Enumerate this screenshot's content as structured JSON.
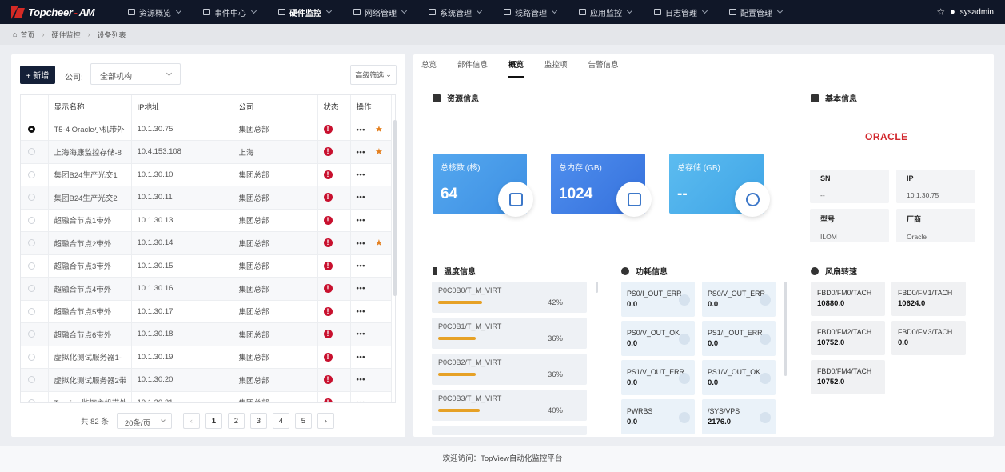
{
  "app": {
    "brand": "Topcheer",
    "brand_suffix": "AM",
    "user": "sysadmin"
  },
  "nav": [
    {
      "label": "资源概览",
      "active": false
    },
    {
      "label": "事件中心",
      "active": false
    },
    {
      "label": "硬件监控",
      "active": true
    },
    {
      "label": "网络管理",
      "active": false
    },
    {
      "label": "系统管理",
      "active": false
    },
    {
      "label": "线路管理",
      "active": false
    },
    {
      "label": "应用监控",
      "active": false
    },
    {
      "label": "日志管理",
      "active": false
    },
    {
      "label": "配置管理",
      "active": false
    }
  ],
  "breadcrumb": [
    "首页",
    "硬件监控",
    "设备列表"
  ],
  "toolbar": {
    "new_label": "+ 新增",
    "company_label": "公司:",
    "company_value": "全部机构",
    "advanced_filter": "高级筛选"
  },
  "table": {
    "headers": [
      "显示名称",
      "IP地址",
      "公司",
      "状态",
      "操作"
    ],
    "rows": [
      {
        "name": "T5-4 Oracle小机带外",
        "ip": "10.1.30.75",
        "company": "集团总部",
        "selected": true,
        "starred": true
      },
      {
        "name": "上海海康监控存储-8",
        "ip": "10.4.153.108",
        "company": "上海",
        "selected": false,
        "starred": true
      },
      {
        "name": "集团B24生产光交1",
        "ip": "10.1.30.10",
        "company": "集团总部",
        "selected": false,
        "starred": false
      },
      {
        "name": "集团B24生产光交2",
        "ip": "10.1.30.11",
        "company": "集团总部",
        "selected": false,
        "starred": false
      },
      {
        "name": "超融合节点1带外",
        "ip": "10.1.30.13",
        "company": "集团总部",
        "selected": false,
        "starred": false
      },
      {
        "name": "超融合节点2带外",
        "ip": "10.1.30.14",
        "company": "集团总部",
        "selected": false,
        "starred": true
      },
      {
        "name": "超融合节点3带外",
        "ip": "10.1.30.15",
        "company": "集团总部",
        "selected": false,
        "starred": false
      },
      {
        "name": "超融合节点4带外",
        "ip": "10.1.30.16",
        "company": "集团总部",
        "selected": false,
        "starred": false
      },
      {
        "name": "超融合节点5带外",
        "ip": "10.1.30.17",
        "company": "集团总部",
        "selected": false,
        "starred": false
      },
      {
        "name": "超融合节点6带外",
        "ip": "10.1.30.18",
        "company": "集团总部",
        "selected": false,
        "starred": false
      },
      {
        "name": "虚拟化测试服务器1-",
        "ip": "10.1.30.19",
        "company": "集团总部",
        "selected": false,
        "starred": false
      },
      {
        "name": "虚拟化测试服务器2带",
        "ip": "10.1.30.20",
        "company": "集团总部",
        "selected": false,
        "starred": false
      },
      {
        "name": "Topview监控主机带外",
        "ip": "10.1.30.21",
        "company": "集团总部",
        "selected": false,
        "starred": false
      }
    ]
  },
  "pagination": {
    "total": "共 82 条",
    "page_size": "20条/页",
    "pages": [
      "1",
      "2",
      "3",
      "4",
      "5"
    ]
  },
  "detail_tabs": [
    {
      "label": "总览",
      "active": false
    },
    {
      "label": "部件信息",
      "active": false
    },
    {
      "label": "概览",
      "active": true
    },
    {
      "label": "监控项",
      "active": false
    },
    {
      "label": "告警信息",
      "active": false
    }
  ],
  "resource": {
    "title": "资源信息",
    "cards": [
      {
        "label": "总核数 (核)",
        "value": "64",
        "color": "#4a9ded",
        "icon": "cpu-icon"
      },
      {
        "label": "总内存 (GB)",
        "value": "1024",
        "color": "#3f7fe3",
        "icon": "memory-icon"
      },
      {
        "label": "总存储 (GB)",
        "value": "--",
        "color": "#4cb0ea",
        "icon": "storage-icon"
      }
    ]
  },
  "basic": {
    "title": "基本信息",
    "vendor_logo": "ORACLE",
    "fields": [
      {
        "key": "SN",
        "value": "--"
      },
      {
        "key": "IP",
        "value": "10.1.30.75"
      },
      {
        "key": "型号",
        "value": "ILOM"
      },
      {
        "key": "厂商",
        "value": "Oracle"
      }
    ]
  },
  "temperature": {
    "title": "温度信息",
    "items": [
      {
        "name": "P0C0B0/T_M_VIRT",
        "percent": "42%",
        "level": 0.42
      },
      {
        "name": "P0C0B1/T_M_VIRT",
        "percent": "36%",
        "level": 0.36
      },
      {
        "name": "P0C0B2/T_M_VIRT",
        "percent": "36%",
        "level": 0.36
      },
      {
        "name": "P0C0B3/T_M_VIRT",
        "percent": "40%",
        "level": 0.4
      }
    ]
  },
  "power": {
    "title": "功耗信息",
    "items": [
      {
        "name": "PS0/I_OUT_ERR",
        "value": "0.0"
      },
      {
        "name": "PS0/V_OUT_ERR",
        "value": "0.0"
      },
      {
        "name": "PS0/V_OUT_OK",
        "value": "0.0"
      },
      {
        "name": "PS1/I_OUT_ERR",
        "value": "0.0"
      },
      {
        "name": "PS1/V_OUT_ERR",
        "value": "0.0"
      },
      {
        "name": "PS1/V_OUT_OK",
        "value": "0.0"
      },
      {
        "name": "PWRBS",
        "value": "0.0"
      },
      {
        "name": "/SYS/VPS",
        "value": "2176.0"
      }
    ]
  },
  "fan": {
    "title": "风扇转速",
    "items": [
      {
        "name": "FBD0/FM0/TACH",
        "value": "10880.0"
      },
      {
        "name": "FBD0/FM1/TACH",
        "value": "10624.0"
      },
      {
        "name": "FBD0/FM2/TACH",
        "value": "10752.0"
      },
      {
        "name": "FBD0/FM3/TACH",
        "value": "0.0"
      },
      {
        "name": "FBD0/FM4/TACH",
        "value": "10752.0"
      }
    ]
  },
  "footer": "欢迎访问：TopView自动化监控平台"
}
